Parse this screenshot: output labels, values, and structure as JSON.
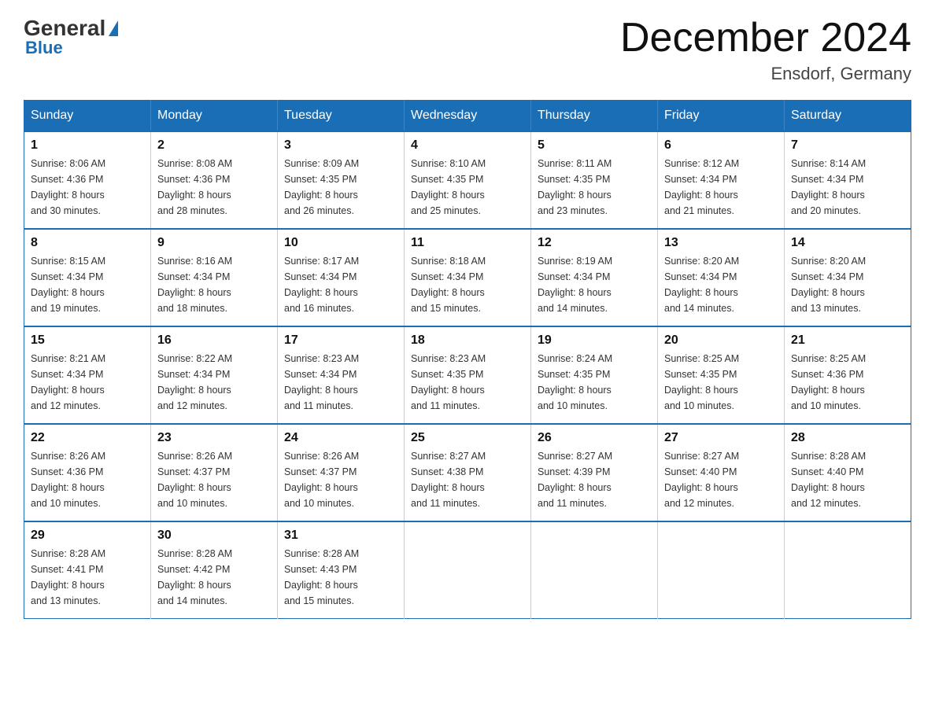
{
  "header": {
    "logo": {
      "general": "General",
      "blue": "Blue"
    },
    "title": "December 2024",
    "location": "Ensdorf, Germany"
  },
  "days_of_week": [
    "Sunday",
    "Monday",
    "Tuesday",
    "Wednesday",
    "Thursday",
    "Friday",
    "Saturday"
  ],
  "weeks": [
    [
      {
        "day": "1",
        "sunrise": "Sunrise: 8:06 AM",
        "sunset": "Sunset: 4:36 PM",
        "daylight": "Daylight: 8 hours and 30 minutes."
      },
      {
        "day": "2",
        "sunrise": "Sunrise: 8:08 AM",
        "sunset": "Sunset: 4:36 PM",
        "daylight": "Daylight: 8 hours and 28 minutes."
      },
      {
        "day": "3",
        "sunrise": "Sunrise: 8:09 AM",
        "sunset": "Sunset: 4:35 PM",
        "daylight": "Daylight: 8 hours and 26 minutes."
      },
      {
        "day": "4",
        "sunrise": "Sunrise: 8:10 AM",
        "sunset": "Sunset: 4:35 PM",
        "daylight": "Daylight: 8 hours and 25 minutes."
      },
      {
        "day": "5",
        "sunrise": "Sunrise: 8:11 AM",
        "sunset": "Sunset: 4:35 PM",
        "daylight": "Daylight: 8 hours and 23 minutes."
      },
      {
        "day": "6",
        "sunrise": "Sunrise: 8:12 AM",
        "sunset": "Sunset: 4:34 PM",
        "daylight": "Daylight: 8 hours and 21 minutes."
      },
      {
        "day": "7",
        "sunrise": "Sunrise: 8:14 AM",
        "sunset": "Sunset: 4:34 PM",
        "daylight": "Daylight: 8 hours and 20 minutes."
      }
    ],
    [
      {
        "day": "8",
        "sunrise": "Sunrise: 8:15 AM",
        "sunset": "Sunset: 4:34 PM",
        "daylight": "Daylight: 8 hours and 19 minutes."
      },
      {
        "day": "9",
        "sunrise": "Sunrise: 8:16 AM",
        "sunset": "Sunset: 4:34 PM",
        "daylight": "Daylight: 8 hours and 18 minutes."
      },
      {
        "day": "10",
        "sunrise": "Sunrise: 8:17 AM",
        "sunset": "Sunset: 4:34 PM",
        "daylight": "Daylight: 8 hours and 16 minutes."
      },
      {
        "day": "11",
        "sunrise": "Sunrise: 8:18 AM",
        "sunset": "Sunset: 4:34 PM",
        "daylight": "Daylight: 8 hours and 15 minutes."
      },
      {
        "day": "12",
        "sunrise": "Sunrise: 8:19 AM",
        "sunset": "Sunset: 4:34 PM",
        "daylight": "Daylight: 8 hours and 14 minutes."
      },
      {
        "day": "13",
        "sunrise": "Sunrise: 8:20 AM",
        "sunset": "Sunset: 4:34 PM",
        "daylight": "Daylight: 8 hours and 14 minutes."
      },
      {
        "day": "14",
        "sunrise": "Sunrise: 8:20 AM",
        "sunset": "Sunset: 4:34 PM",
        "daylight": "Daylight: 8 hours and 13 minutes."
      }
    ],
    [
      {
        "day": "15",
        "sunrise": "Sunrise: 8:21 AM",
        "sunset": "Sunset: 4:34 PM",
        "daylight": "Daylight: 8 hours and 12 minutes."
      },
      {
        "day": "16",
        "sunrise": "Sunrise: 8:22 AM",
        "sunset": "Sunset: 4:34 PM",
        "daylight": "Daylight: 8 hours and 12 minutes."
      },
      {
        "day": "17",
        "sunrise": "Sunrise: 8:23 AM",
        "sunset": "Sunset: 4:34 PM",
        "daylight": "Daylight: 8 hours and 11 minutes."
      },
      {
        "day": "18",
        "sunrise": "Sunrise: 8:23 AM",
        "sunset": "Sunset: 4:35 PM",
        "daylight": "Daylight: 8 hours and 11 minutes."
      },
      {
        "day": "19",
        "sunrise": "Sunrise: 8:24 AM",
        "sunset": "Sunset: 4:35 PM",
        "daylight": "Daylight: 8 hours and 10 minutes."
      },
      {
        "day": "20",
        "sunrise": "Sunrise: 8:25 AM",
        "sunset": "Sunset: 4:35 PM",
        "daylight": "Daylight: 8 hours and 10 minutes."
      },
      {
        "day": "21",
        "sunrise": "Sunrise: 8:25 AM",
        "sunset": "Sunset: 4:36 PM",
        "daylight": "Daylight: 8 hours and 10 minutes."
      }
    ],
    [
      {
        "day": "22",
        "sunrise": "Sunrise: 8:26 AM",
        "sunset": "Sunset: 4:36 PM",
        "daylight": "Daylight: 8 hours and 10 minutes."
      },
      {
        "day": "23",
        "sunrise": "Sunrise: 8:26 AM",
        "sunset": "Sunset: 4:37 PM",
        "daylight": "Daylight: 8 hours and 10 minutes."
      },
      {
        "day": "24",
        "sunrise": "Sunrise: 8:26 AM",
        "sunset": "Sunset: 4:37 PM",
        "daylight": "Daylight: 8 hours and 10 minutes."
      },
      {
        "day": "25",
        "sunrise": "Sunrise: 8:27 AM",
        "sunset": "Sunset: 4:38 PM",
        "daylight": "Daylight: 8 hours and 11 minutes."
      },
      {
        "day": "26",
        "sunrise": "Sunrise: 8:27 AM",
        "sunset": "Sunset: 4:39 PM",
        "daylight": "Daylight: 8 hours and 11 minutes."
      },
      {
        "day": "27",
        "sunrise": "Sunrise: 8:27 AM",
        "sunset": "Sunset: 4:40 PM",
        "daylight": "Daylight: 8 hours and 12 minutes."
      },
      {
        "day": "28",
        "sunrise": "Sunrise: 8:28 AM",
        "sunset": "Sunset: 4:40 PM",
        "daylight": "Daylight: 8 hours and 12 minutes."
      }
    ],
    [
      {
        "day": "29",
        "sunrise": "Sunrise: 8:28 AM",
        "sunset": "Sunset: 4:41 PM",
        "daylight": "Daylight: 8 hours and 13 minutes."
      },
      {
        "day": "30",
        "sunrise": "Sunrise: 8:28 AM",
        "sunset": "Sunset: 4:42 PM",
        "daylight": "Daylight: 8 hours and 14 minutes."
      },
      {
        "day": "31",
        "sunrise": "Sunrise: 8:28 AM",
        "sunset": "Sunset: 4:43 PM",
        "daylight": "Daylight: 8 hours and 15 minutes."
      },
      null,
      null,
      null,
      null
    ]
  ]
}
